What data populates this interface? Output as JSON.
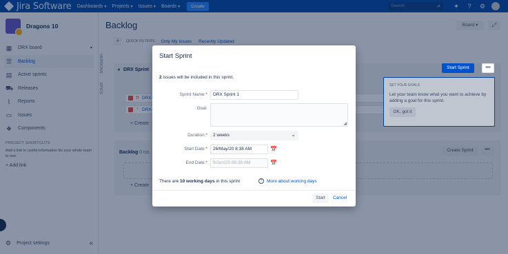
{
  "topnav": {
    "logo_text": "Jira Software",
    "items": [
      "Dashboards",
      "Projects",
      "Issues",
      "Boards"
    ],
    "create_label": "Create",
    "search_placeholder": "Search"
  },
  "sidebar": {
    "project_name": "Dragons 10",
    "board_label": "DRX board",
    "items": [
      {
        "label": "Backlog",
        "icon": "backlog-icon"
      },
      {
        "label": "Active sprints",
        "icon": "active-sprints-icon"
      },
      {
        "label": "Releases",
        "icon": "releases-icon"
      },
      {
        "label": "Reports",
        "icon": "reports-icon"
      },
      {
        "label": "Issues",
        "icon": "issues-icon"
      },
      {
        "label": "Components",
        "icon": "components-icon"
      }
    ],
    "shortcuts_title": "PROJECT SHORTCUTS",
    "shortcuts_desc": "Add a link to useful information for your whole team to see.",
    "add_link": "+ Add link",
    "project_settings": "Project settings"
  },
  "vtabs": [
    "VERSIONS",
    "EPICS"
  ],
  "main": {
    "title": "Backlog",
    "board_btn": "Board",
    "quick_filters": "QUICK FILTERS:",
    "filter_links": [
      "Only My Issues",
      "Recently Updated"
    ],
    "sprint_name": "DRX Sprint",
    "start_sprint_btn": "Start Sprint",
    "more": "•••",
    "issue_keys": [
      "DRX-",
      "DRX-"
    ],
    "create_issue": "+ Create",
    "backlog_title": "Backlog",
    "backlog_count": "0 iss",
    "create_sprint_btn": "Create Sprint"
  },
  "goals": {
    "title": "SET YOUR GOALS",
    "text": "Let your team know what you want to achieve by adding a goal for this sprint.",
    "btn": "OK, got it"
  },
  "modal": {
    "title": "Start Sprint",
    "info_count": "2",
    "info_text": " issues will be included in this sprint.",
    "sprint_name_label": "Sprint Name:",
    "sprint_name_value": "DRX Sprint 1",
    "goal_label": "Goal:",
    "duration_label": "Duration:",
    "duration_value": "2 weeks",
    "start_date_label": "Start Date:",
    "start_date_value": "26/May/20 8:38 AM",
    "end_date_label": "End Date:",
    "end_date_value": "9/Jun/20 08:38 AM",
    "working_pre": "There are ",
    "working_days": "10 working days",
    "working_post": " in this sprint",
    "help_link": "More about working days",
    "start_btn": "Start",
    "cancel_btn": "Cancel"
  }
}
